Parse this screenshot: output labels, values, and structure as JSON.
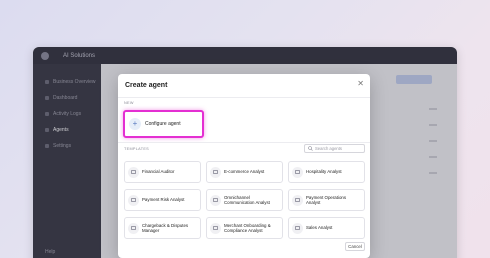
{
  "app": {
    "title": "AI Solutions",
    "sidebar_items": [
      {
        "label": "Business Overview"
      },
      {
        "label": "Dashboard"
      },
      {
        "label": "Activity Logs"
      },
      {
        "label": "Agents"
      },
      {
        "label": "Settings"
      }
    ],
    "sidebar_footer": "Help"
  },
  "modal": {
    "title": "Create agent",
    "close_glyph": "✕",
    "new_section_label": "NEW",
    "configure_label": "Configure agent",
    "templates_section_label": "TEMPLATES",
    "search": {
      "placeholder": "Search agents",
      "value": ""
    },
    "templates": [
      {
        "label": "Financial Auditor"
      },
      {
        "label": "E-commerce Analyst"
      },
      {
        "label": "Hospitality Analyst"
      },
      {
        "label": "Payment Risk Analyst"
      },
      {
        "label": "Omnichannel Communication Analyst"
      },
      {
        "label": "Payment Operations Analyst"
      },
      {
        "label": "Chargeback & Disputes Manager"
      },
      {
        "label": "Merchant Onboarding & Compliance Analyst"
      },
      {
        "label": "Sales Analyst"
      }
    ],
    "cancel_label": "Cancel"
  },
  "colors": {
    "highlight": "#e42fd2",
    "accent": "#5a7bc0"
  }
}
